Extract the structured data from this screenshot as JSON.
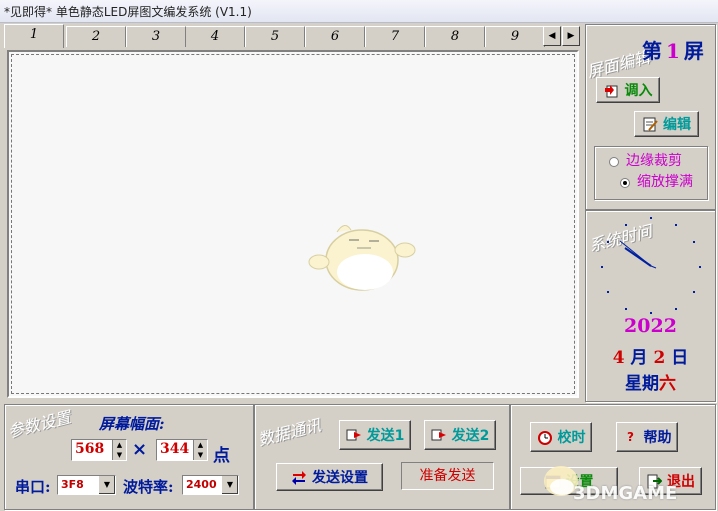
{
  "window": {
    "title": "*见即得* 单色静态LED屏图文编发系统 (V1.1)"
  },
  "tabs": [
    "1",
    "2",
    "3",
    "4",
    "5",
    "6",
    "7",
    "8",
    "9"
  ],
  "active_tab": "1",
  "tab_scroll": {
    "left": "◀",
    "right": "▶"
  },
  "screen_edit": {
    "watermark": "屏面编辑",
    "screen_prefix": "第",
    "screen_number": "1",
    "screen_suffix": "屏",
    "import_label": "调入",
    "edit_label": "编辑",
    "radio_options": [
      "边缘裁剪",
      "缩放撑满"
    ],
    "selected_option": "缩放撑满"
  },
  "system_time": {
    "watermark": "系统时间",
    "year": "2022",
    "month": "4",
    "month_unit": "月",
    "day": "2",
    "day_unit": "日",
    "weekday_prefix": "星期",
    "weekday": "六"
  },
  "params": {
    "watermark": "参数设置",
    "screen_size_label": "屏幕幅面:",
    "width": "568",
    "times": "×",
    "height": "344",
    "unit": "点",
    "port_label": "串口:",
    "port_value": "3F8",
    "baud_label": "波特率:",
    "baud_value": "2400"
  },
  "comm": {
    "watermark": "数据通讯",
    "send1_label": "发送1",
    "send2_label": "发送2",
    "send_settings_label": "发送设置",
    "status_text": "准备发送"
  },
  "actions": {
    "sync_time_label": "校时",
    "help_label": "帮助",
    "settings_label": "设置",
    "exit_label": "退出"
  },
  "overlay": {
    "watermark_text": "3DMGAME"
  },
  "colors": {
    "title_blue": "#001a9c",
    "red": "#d00000",
    "magenta": "#cc00cc",
    "cyan": "#009a9a"
  }
}
